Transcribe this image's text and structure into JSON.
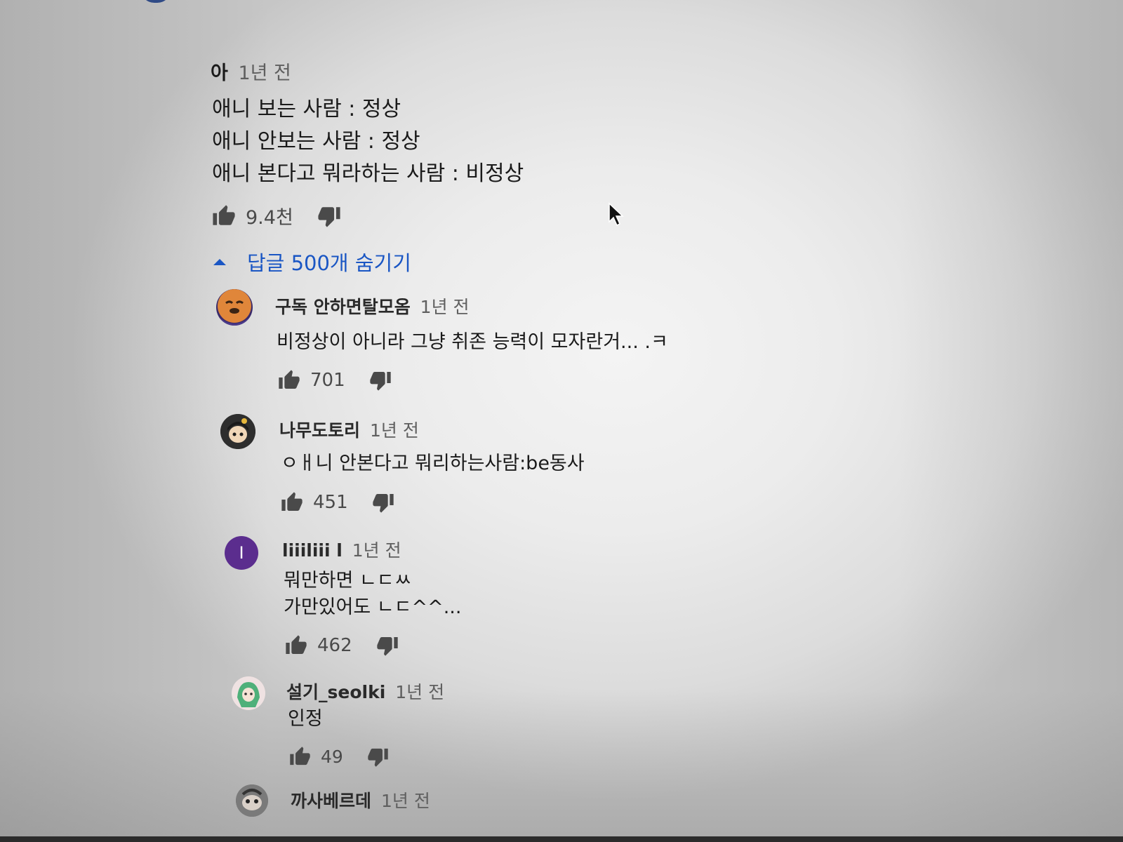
{
  "top_comment": {
    "author": "아",
    "time": "1년 전",
    "lines": [
      "애니 보는 사람 : 정상",
      "애니 안보는 사람 : 정상",
      "애니 본다고 뭐라하는 사람 : 비정상"
    ],
    "likes": "9.4천",
    "like_icon": "thumb-up-icon",
    "dislike_icon": "thumb-down-icon"
  },
  "replies_toggle": {
    "label": "답글 500개 숨기기",
    "icon": "caret-up-icon",
    "color": "#1a56c4"
  },
  "replies": [
    {
      "author": "구독 안하면탈모옴",
      "time": "1년 전",
      "lines": [
        "비정상이 아니라 그냥 취존 능력이 모자란거... .ㅋ"
      ],
      "likes": "701"
    },
    {
      "author": "나무도토리",
      "time": "1년 전",
      "lines": [
        "ㅇㅐ니 안본다고 뭐리하는사람:be동사"
      ],
      "likes": "451"
    },
    {
      "author": "liiiliii l",
      "time": "1년 전",
      "avatar_letter": "I",
      "avatar_color": "#5b2d8e",
      "lines": [
        "뭐만하면 ㄴㄷㅆ",
        "가만있어도 ㄴㄷ^^..."
      ],
      "likes": "462"
    },
    {
      "author": "설기_seolki",
      "time": "1년 전",
      "lines": [
        "인정"
      ],
      "likes": "49"
    },
    {
      "author": "까사베르데",
      "time": "1년 전"
    }
  ]
}
